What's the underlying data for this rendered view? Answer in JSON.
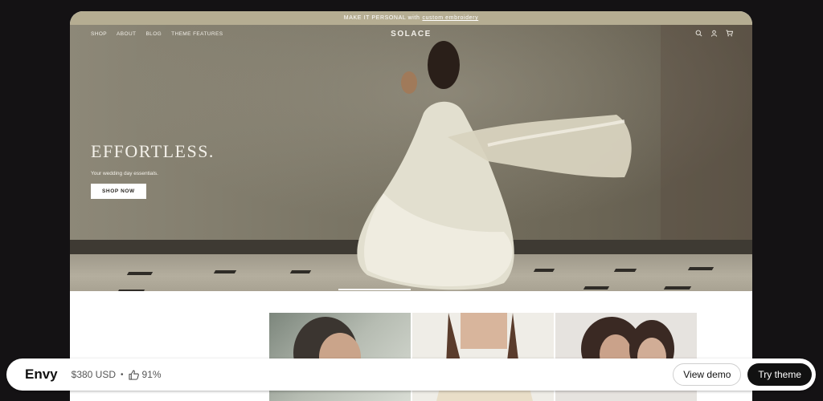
{
  "announcement": {
    "prefix": "MAKE IT PERSONAL with",
    "link": "custom embroidery"
  },
  "nav": {
    "links": [
      "SHOP",
      "ABOUT",
      "BLOG",
      "THEME FEATURES"
    ],
    "brand": "SOLACE",
    "icons": [
      "search-icon",
      "account-icon",
      "cart-icon"
    ]
  },
  "hero": {
    "headline": "EFFORTLESS.",
    "subtitle": "Your wedding day essentials.",
    "cta": "SHOP NOW"
  },
  "bottom_bar": {
    "theme_name": "Envy",
    "price": "$380 USD",
    "separator": "•",
    "rating": "91%",
    "view_demo": "View demo",
    "try_theme": "Try theme"
  },
  "colors": {
    "announcement_bg": "#b5ad92",
    "page_bg": "#141214",
    "primary_button": "#111111"
  }
}
